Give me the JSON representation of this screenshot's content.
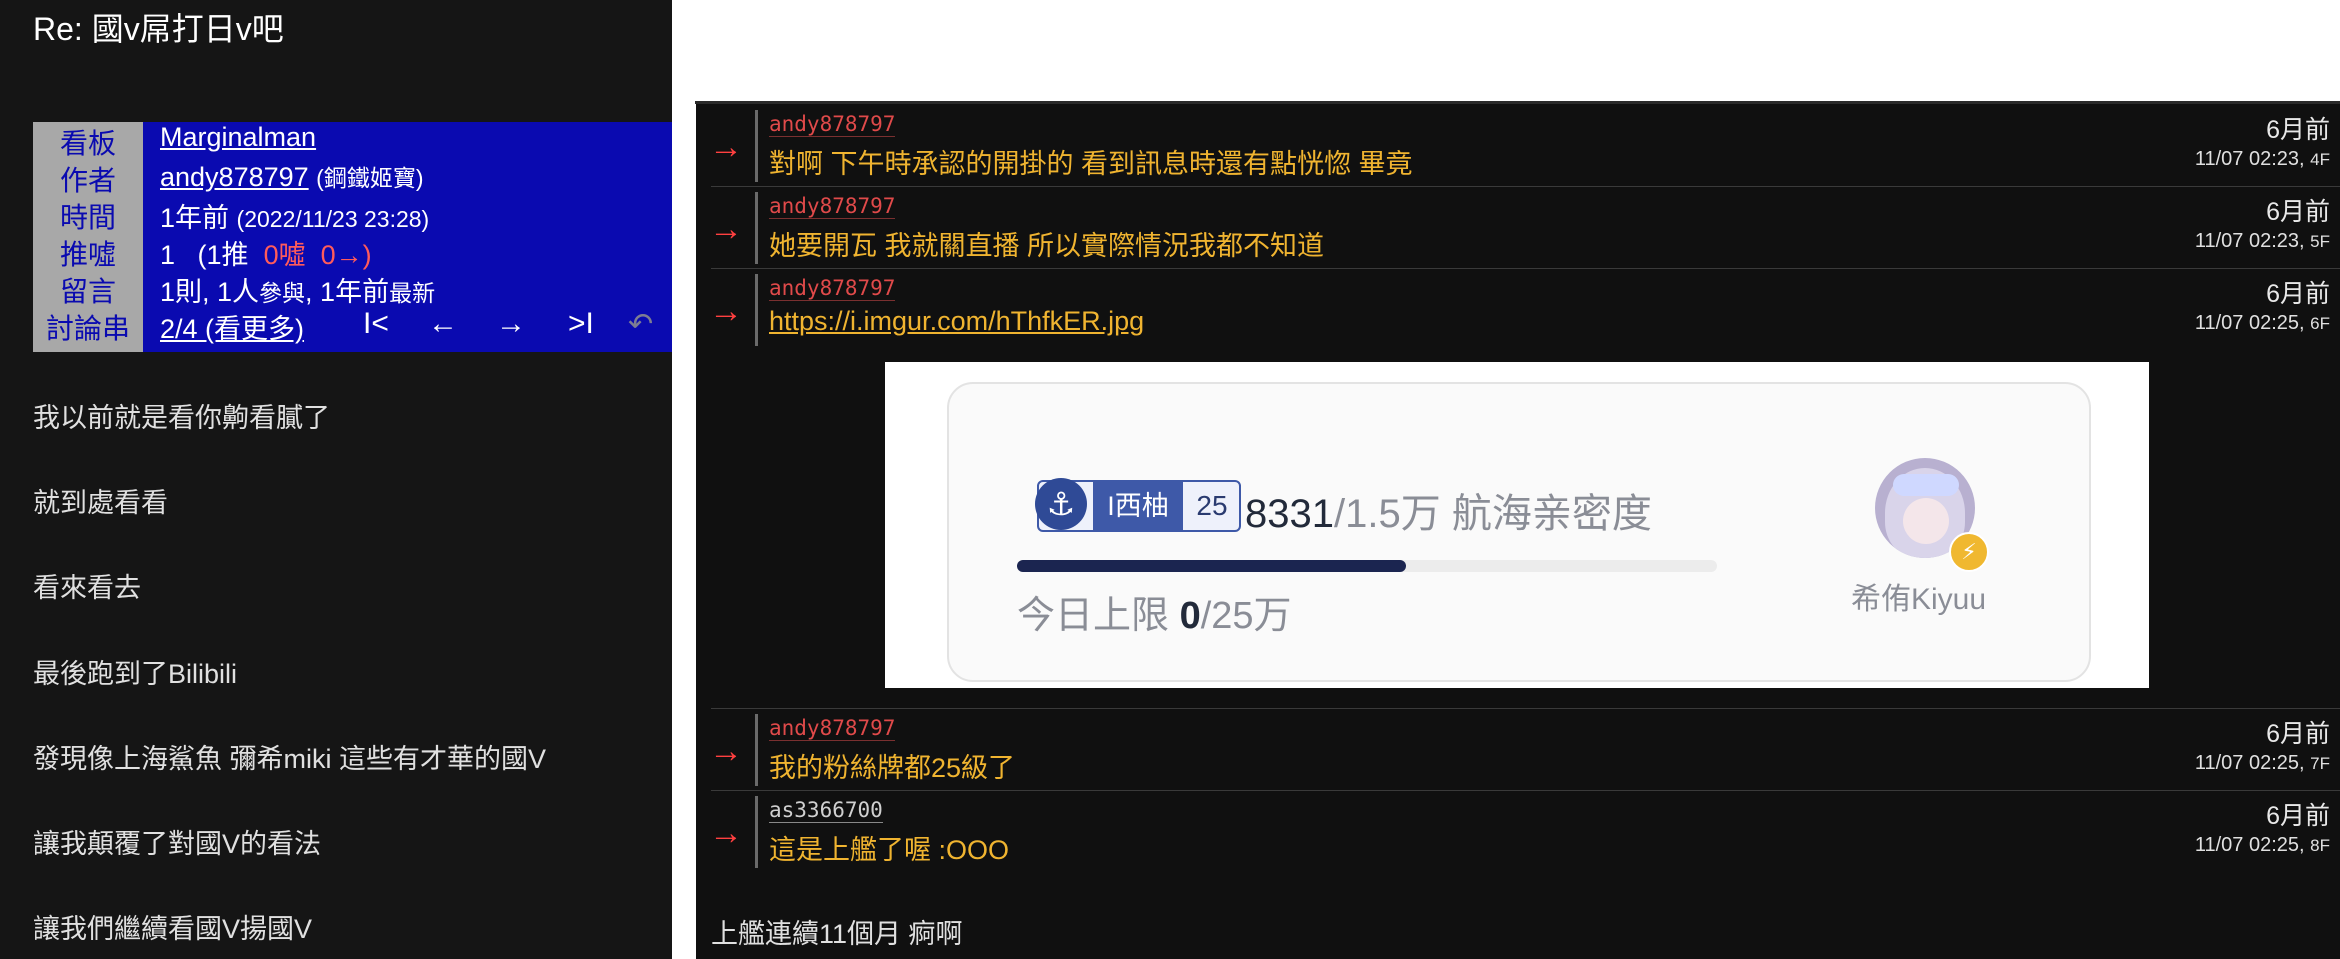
{
  "post": {
    "title": "Re: 國v屌打日v吧",
    "meta": {
      "labels": {
        "board": "看板",
        "author": "作者",
        "time": "時間",
        "votes": "推噓",
        "comments": "留言",
        "thread": "討論串"
      },
      "board": "Marginalman",
      "author_id": "andy878797",
      "author_nick": "(鋼鐵姬寶)",
      "time_ago": "1年前",
      "time_full": "(2022/11/23 23:28)",
      "votes_total": "1",
      "votes_open": "(1推",
      "votes_boo": "0噓",
      "votes_arrow": "0→)",
      "comments_text": "1則, 1人",
      "comments_participate": "參與",
      "comments_sep": ", 1年前",
      "comments_latest": "最新",
      "thread_pos": "2/4 (看更多)",
      "nav": {
        "first": "I<",
        "prev": "←",
        "next": "→",
        "last": ">I",
        "back": "↶"
      }
    },
    "body_lines": [
      "我以前就是看你齁看膩了",
      "就到處看看",
      "看來看去",
      "最後跑到了Bilibili",
      "發現像上海鯊魚 彌希miki 這些有才華的國V",
      "讓我顛覆了對國V的看法",
      "讓我們繼續看國V揚國V"
    ]
  },
  "comments": [
    {
      "arrow": "→",
      "user": "andy878797",
      "content": "對啊 下午時承認的開掛的 看到訊息時還有點恍惚 畢竟",
      "ago": "6月前",
      "time": "11/07 02:23, ",
      "floor": "4F"
    },
    {
      "arrow": "→",
      "user": "andy878797",
      "content": "她要開瓦 我就關直播 所以實際情況我都不知道",
      "ago": "6月前",
      "time": "11/07 02:23, ",
      "floor": "5F"
    },
    {
      "arrow": "→",
      "user": "andy878797",
      "content": "https://i.imgur.com/hThfkER.jpg",
      "ago": "6月前",
      "time": "11/07 02:25, ",
      "floor": "6F"
    },
    {
      "arrow": "→",
      "user": "andy878797",
      "content": "我的粉絲牌都25級了",
      "ago": "6月前",
      "time": "11/07 02:25, ",
      "floor": "7F"
    },
    {
      "arrow": "→",
      "user": "as3366700",
      "content": "這是上艦了喔 :OOO",
      "ago": "6月前",
      "time": "11/07 02:25, ",
      "floor": "8F"
    }
  ],
  "embedded_image": {
    "badge_icon": "anchor-icon",
    "badge_name": "I西柚",
    "badge_level": "25",
    "intimacy_current": "8331",
    "intimacy_rest": "/1.5万 航海亲密度",
    "progress_fraction": 0.555,
    "limit_label": "今日上限 ",
    "limit_current": "0",
    "limit_rest": "/25万",
    "vtuber_name": "希侑Kiyuu",
    "bolt_icon": "lightning-icon",
    "colors": {
      "badge": "#3e59a8",
      "bar_fill": "#1b2550",
      "bolt": "#f0b830"
    }
  },
  "footer_text": "上艦連續11個月 痾啊",
  "colors": {
    "background": "#151515",
    "meta_bg": "#0a0ab0",
    "meta_label_bg": "#a8a8a8",
    "push_arrow": "#ff4040",
    "push_user": "#e04a4a",
    "push_content": "#f0b430",
    "boo_red": "#ff5b5b"
  }
}
